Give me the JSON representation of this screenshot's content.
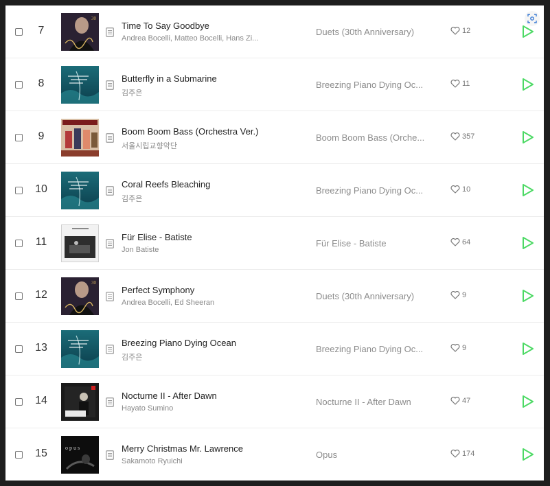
{
  "accent_color": "#4cd964",
  "icons": {
    "capture": "screen-capture-icon",
    "lyrics": "document-icon",
    "like": "heart-outline-icon",
    "play": "play-icon"
  },
  "songs": [
    {
      "rank": "7",
      "title": "Time To Say Goodbye",
      "artist": "Andrea Bocelli, Matteo Bocelli, Hans Zi...",
      "album": "Duets (30th Anniversary)",
      "likes": "12",
      "cover": "duets"
    },
    {
      "rank": "8",
      "title": "Butterfly in a Submarine",
      "artist": "김주은",
      "album": "Breezing Piano Dying Oc...",
      "likes": "11",
      "cover": "ocean"
    },
    {
      "rank": "9",
      "title": "Boom Boom Bass (Orchestra Ver.)",
      "artist": "서울시립교향악단",
      "album": "Boom Boom Bass (Orche...",
      "likes": "357",
      "cover": "boom"
    },
    {
      "rank": "10",
      "title": "Coral Reefs Bleaching",
      "artist": "김주은",
      "album": "Breezing Piano Dying Oc...",
      "likes": "10",
      "cover": "ocean"
    },
    {
      "rank": "11",
      "title": "Für Elise - Batiste",
      "artist": "Jon Batiste",
      "album": "Für Elise - Batiste",
      "likes": "64",
      "cover": "batiste"
    },
    {
      "rank": "12",
      "title": "Perfect Symphony",
      "artist": "Andrea Bocelli, Ed Sheeran",
      "album": "Duets (30th Anniversary)",
      "likes": "9",
      "cover": "duets"
    },
    {
      "rank": "13",
      "title": "Breezing Piano Dying Ocean",
      "artist": "김주은",
      "album": "Breezing Piano Dying Oc...",
      "likes": "9",
      "cover": "ocean"
    },
    {
      "rank": "14",
      "title": "Nocturne II - After Dawn",
      "artist": "Hayato Sumino",
      "album": "Nocturne II - After Dawn",
      "likes": "47",
      "cover": "nocturne"
    },
    {
      "rank": "15",
      "title": "Merry Christmas Mr. Lawrence",
      "artist": "Sakamoto Ryuichi",
      "album": "Opus",
      "likes": "174",
      "cover": "opus"
    }
  ]
}
